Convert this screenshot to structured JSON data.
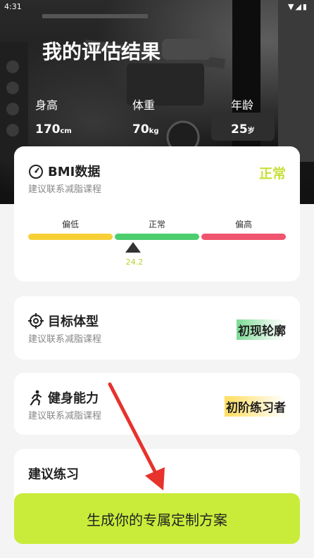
{
  "status_bar": {
    "time": "4:31",
    "icons": "▼◢▮"
  },
  "hero": {
    "title": "我的评估结果",
    "stats": [
      {
        "label": "身高",
        "value": "170",
        "unit": "cm"
      },
      {
        "label": "体重",
        "value": "70",
        "unit": "kg"
      },
      {
        "label": "年龄",
        "value": "25",
        "unit": "岁"
      }
    ]
  },
  "bmi_card": {
    "title": "BMI数据",
    "subtitle": "建议联系减脂课程",
    "status": "正常",
    "scale": [
      {
        "label": "偏低",
        "color": "#f7d037"
      },
      {
        "label": "正常",
        "color": "#4ccd6e"
      },
      {
        "label": "偏高",
        "color": "#f0546e"
      }
    ],
    "value": "24.2",
    "icon": "speedometer-icon"
  },
  "target_card": {
    "title": "目标体型",
    "subtitle": "建议联系减脂课程",
    "tag": "初现轮廓",
    "icon": "crosshair-icon"
  },
  "fitness_card": {
    "title": "健身能力",
    "subtitle": "建议联系减脂课程",
    "tag": "初阶练习者",
    "icon": "running-person-icon"
  },
  "practice_card": {
    "title": "建议练习"
  },
  "cta": {
    "label": "生成你的专属定制方案"
  },
  "colors": {
    "accent": "#c9ec3a",
    "status_text": "#c9e03a",
    "annotation_arrow": "#e8322c"
  }
}
